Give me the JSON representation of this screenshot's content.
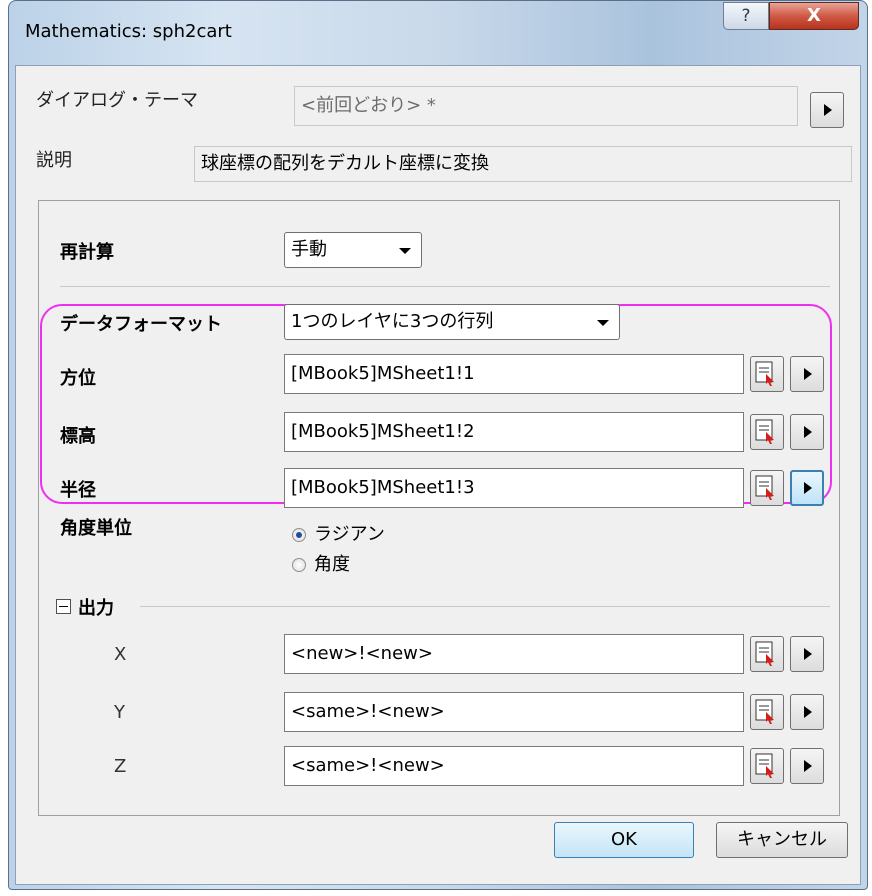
{
  "window": {
    "title": "Mathematics: sph2cart",
    "help_glyph": "?",
    "close_glyph": "X"
  },
  "theme": {
    "label": "ダイアログ・テーマ",
    "value": "<前回どおり> *"
  },
  "description": {
    "label": "説明",
    "value": "球座標の配列をデカルト座標に変換"
  },
  "recalc": {
    "label": "再計算",
    "value": "手動"
  },
  "data_format": {
    "label": "データフォーマット",
    "value": "1つのレイヤに3つの行列"
  },
  "inputs": [
    {
      "label": "方位",
      "value": "[MBook5]MSheet1!1"
    },
    {
      "label": "標高",
      "value": "[MBook5]MSheet1!2"
    },
    {
      "label": "半径",
      "value": "[MBook5]MSheet1!3"
    }
  ],
  "angle_unit": {
    "label": "角度単位",
    "options": [
      "ラジアン",
      "角度"
    ],
    "selected": "ラジアン"
  },
  "output": {
    "label": "出力",
    "rows": [
      {
        "label": "X",
        "value": "<new>!<new>"
      },
      {
        "label": "Y",
        "value": "<same>!<new>"
      },
      {
        "label": "Z",
        "value": "<same>!<new>"
      }
    ]
  },
  "buttons": {
    "ok": "OK",
    "cancel": "キャンセル"
  },
  "colors": {
    "highlight": "#ef2ff0",
    "close_button": "#c9432e",
    "focus": "#3c7fb1"
  }
}
